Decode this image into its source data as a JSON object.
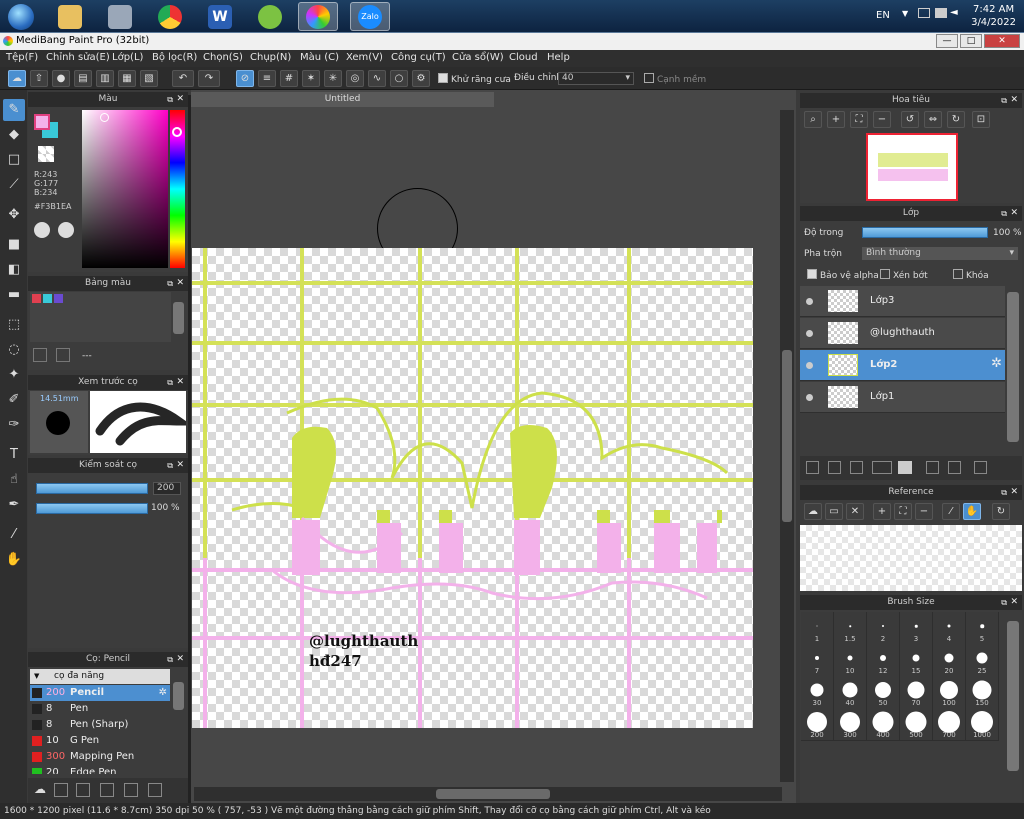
{
  "taskbar": {
    "clock_time": "7:42 AM",
    "clock_date": "3/4/2022",
    "lang": "EN"
  },
  "window": {
    "title": "MediBang Paint Pro (32bit)",
    "min": "—",
    "max": "□",
    "close": "✕"
  },
  "menu": [
    "Tệp(F)",
    "Chỉnh sửa(E)",
    "Lớp(L)",
    "Bộ lọc(R)",
    "Chọn(S)",
    "Chụp(N)",
    "Màu (C)",
    "Xem(V)",
    "Công cụ(T)",
    "Cửa sổ(W)",
    "Cloud",
    "Help"
  ],
  "toolbar": {
    "antialias_label": "Khử răng cưa",
    "adjust_label": "Điều chỉnh",
    "adjust_value": "40",
    "smooth_label": "Cạnh mềm"
  },
  "color_panel": {
    "title": "Màu",
    "r": "R:243",
    "g": "G:177",
    "b": "B:234",
    "hex": "#F3B1EA"
  },
  "palette_panel": {
    "title": "Bảng màu",
    "footer_text": "---"
  },
  "brush_preview_panel": {
    "title": "Xem trước cọ",
    "size": "14.51mm"
  },
  "brush_control_panel": {
    "title": "Kiểm soát cọ",
    "size_value": "200",
    "opacity_value": "100 %"
  },
  "brush_list_panel": {
    "title": "Cọ: Pencil",
    "group": "cọ đa năng",
    "items": [
      {
        "num": "200",
        "name": "Pencil",
        "color": "#222222"
      },
      {
        "num": "8",
        "name": "Pen",
        "color": "#222222"
      },
      {
        "num": "8",
        "name": "Pen (Sharp)",
        "color": "#222222"
      },
      {
        "num": "10",
        "name": "G Pen",
        "color": "#e02020"
      },
      {
        "num": "300",
        "name": "Mapping Pen",
        "color": "#e02020"
      },
      {
        "num": "20",
        "name": "Edge Pen",
        "color": "#20c020"
      }
    ]
  },
  "document": {
    "tab": "Untitled",
    "watermark_line1": "@lughthauth",
    "watermark_line2": "hđ247"
  },
  "navigator_panel": {
    "title": "Hoa tiêu"
  },
  "layer_panel": {
    "title": "Lớp",
    "opacity_label": "Độ trong",
    "opacity_value": "100 %",
    "blend_label": "Pha trộn",
    "blend_value": "Bình thường",
    "protect_alpha": "Bảo vệ alpha",
    "clipping": "Xén bớt",
    "lock": "Khóa",
    "layers": [
      {
        "name": "Lớp3"
      },
      {
        "name": "@lughthauth"
      },
      {
        "name": "Lớp2"
      },
      {
        "name": "Lớp1"
      }
    ]
  },
  "reference_panel": {
    "title": "Reference"
  },
  "brush_size_panel": {
    "title": "Brush Size",
    "sizes": [
      "1",
      "1.5",
      "2",
      "3",
      "4",
      "5",
      "7",
      "10",
      "12",
      "15",
      "20",
      "25",
      "30",
      "40",
      "50",
      "70",
      "100",
      "150",
      "200",
      "300",
      "400",
      "500",
      "700",
      "1000"
    ]
  },
  "status": "1600 * 1200 pixel   (11.6 * 8.7cm)   350 dpi   50 %   ( 757, -53 )   Vẽ một đường thẳng bằng cách giữ phím Shift, Thay đổi cỡ cọ bằng cách giữ phím Ctrl, Alt và kéo",
  "colors": {
    "accent": "#4c8fd0",
    "primary": "#F3B1EA",
    "green_line": "#d4e157",
    "pink_line": "#f3b1ea",
    "lettering_green": "#cde04a"
  }
}
